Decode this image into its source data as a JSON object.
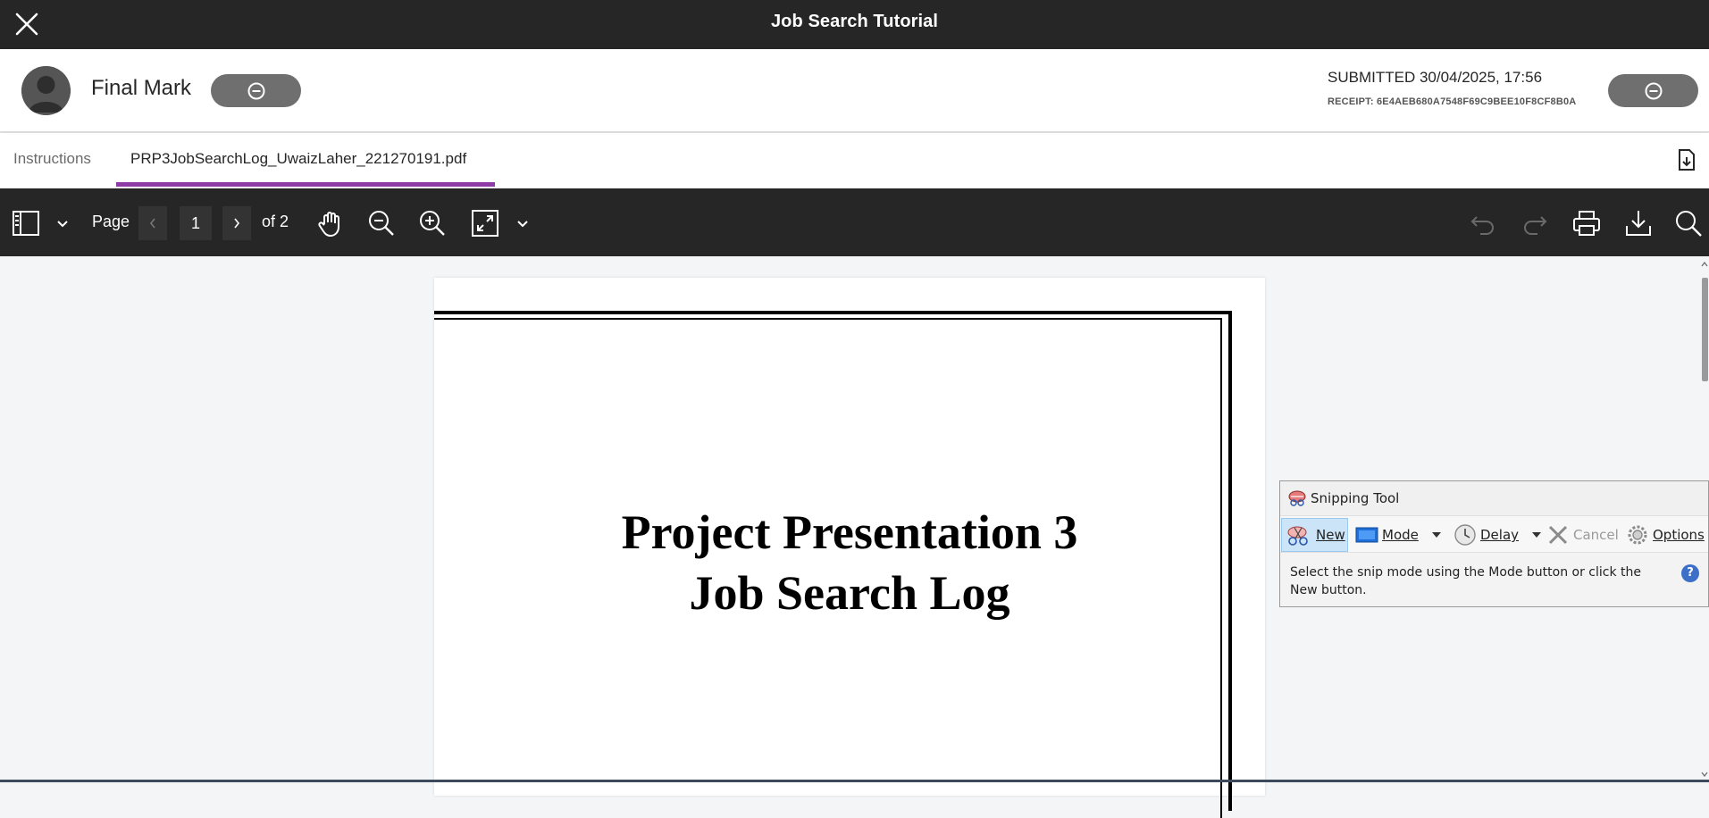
{
  "window": {
    "title": "Job Search Tutorial"
  },
  "header": {
    "final_mark_label": "Final Mark",
    "submitted": "SUBMITTED 30/04/2025, 17:56",
    "receipt": "RECEIPT: 6E4AEB680A7548F69C9BEE10F8CF8B0A"
  },
  "tabs": [
    {
      "label": "Instructions",
      "active": false
    },
    {
      "label": "PRP3JobSearchLog_UwaizLaher_221270191.pdf",
      "active": true
    }
  ],
  "toolbar": {
    "page_label": "Page",
    "current_page": "1",
    "of_label": "of 2"
  },
  "document": {
    "title_line1": "Project Presentation 3",
    "title_line2": "Job Search Log"
  },
  "snipping_tool": {
    "title": "Snipping Tool",
    "new_label": "New",
    "mode_label": "Mode",
    "delay_label": "Delay",
    "cancel_label": "Cancel",
    "options_label": "Options",
    "message": "Select the snip mode using the Mode button or click the New button.",
    "help_glyph": "?"
  },
  "colors": {
    "topbar": "#262626",
    "tab_accent": "#8e3ba6",
    "pill": "#6f6f6f"
  }
}
